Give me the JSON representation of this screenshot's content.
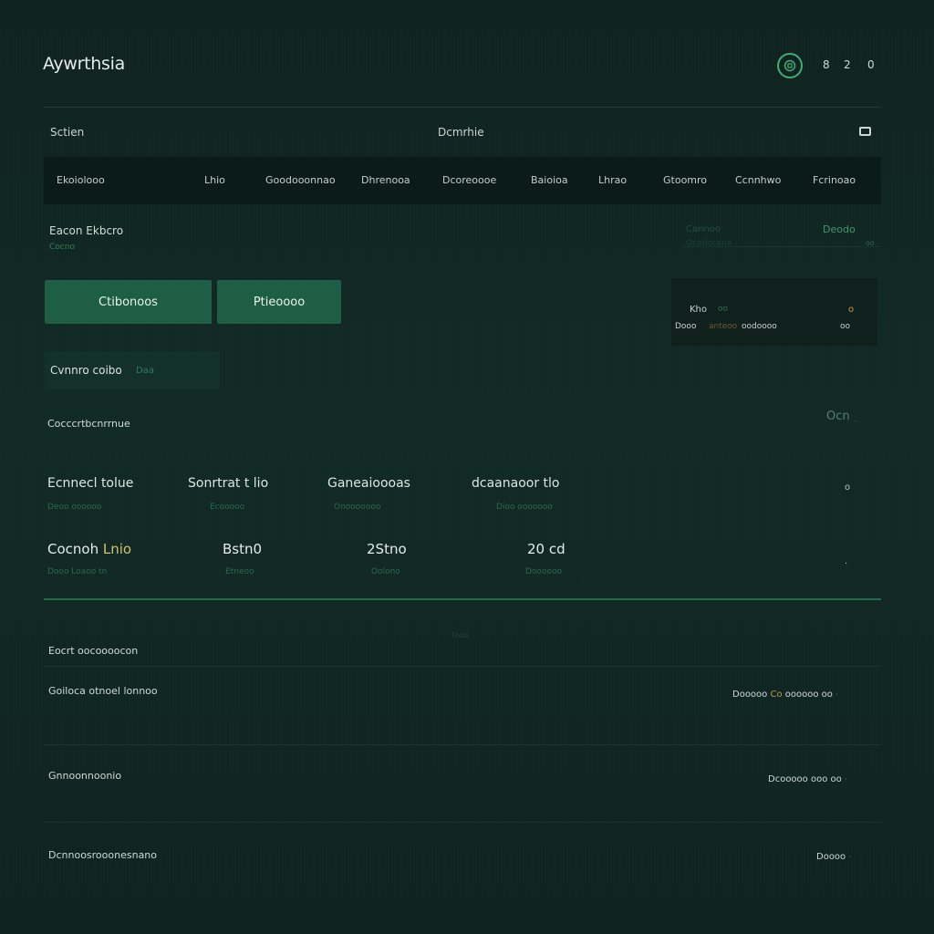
{
  "header": {
    "brand": "Aywrthsia",
    "numbers": [
      "8",
      "2",
      "0"
    ],
    "brand_icon": "wallet-icon"
  },
  "subbar": {
    "left": "Sctien",
    "center": "Dcmrhie",
    "icon": "window-icon"
  },
  "tabs": [
    "Ekoiolooo",
    "Lhio",
    "Goodooonnao",
    "Dhrenooa",
    "Dcoreoooe",
    "Baioioa",
    "Lhrao",
    "Gtoomro",
    "Ccnnhwo",
    "Fcrinoao"
  ],
  "account": {
    "title": "Eacon Ekbcro",
    "subtitle": "Cocno",
    "right_muted": "Cannoo",
    "right_muted2": "Ocedocene",
    "right_green": "Deodo",
    "right_tiny": "oo",
    "primary_button": "Ctibonoos",
    "secondary_button": "Ptieoooo",
    "chip_label": "Cvnnro coibo",
    "chip_sub": "Daa"
  },
  "mini_panel": {
    "line1_label": "Kho",
    "line1_accent": "oo",
    "line1_right": "o",
    "line2_a": "Dooo",
    "line2_b": "anteoo",
    "line2_c": "oodoooo",
    "line2_right": "oo"
  },
  "overview": {
    "title": "Cocccrtbcnrrnue",
    "right": "Ocn",
    "right_tiny": "..",
    "stats": [
      {
        "label": "Ecnnecl tolue",
        "sub": "Deoo oooooo",
        "value": "Cocnoh",
        "value_accent": "Lnio",
        "value_sub": "Dooo Loaoo tn"
      },
      {
        "label": "Sonrtrat t lio",
        "sub": "Ecooooo",
        "value": "Bstn0",
        "value_sub": "Etneoo"
      },
      {
        "label": "Ganeaioooas",
        "sub": "Onooooooo",
        "value": "2Stno",
        "value_sub": "Oolono"
      },
      {
        "label": "dcaanaoor tlo",
        "sub": "Dioo ooooooo",
        "value": "20 cd",
        "value_sub": "Doooooo"
      }
    ],
    "side_glyph_1": "o",
    "side_glyph_2": "."
  },
  "activity": {
    "title": "Eocrt oocoooocon",
    "faint_center": "Tnoo",
    "rows": [
      {
        "label": "Goiloca otnoel lonnoo",
        "right": "Dooooo",
        "right_accent": "Co",
        "right_tail": "oooooo oo"
      },
      {
        "label": "Gnnoonnoonio",
        "right": "Dcooooo ooo",
        "right_accent": "",
        "right_tail": "oo"
      },
      {
        "label": "Dcnnoosrooonesnano",
        "right": "Doooo",
        "right_accent": "",
        "right_tail": ""
      }
    ]
  }
}
